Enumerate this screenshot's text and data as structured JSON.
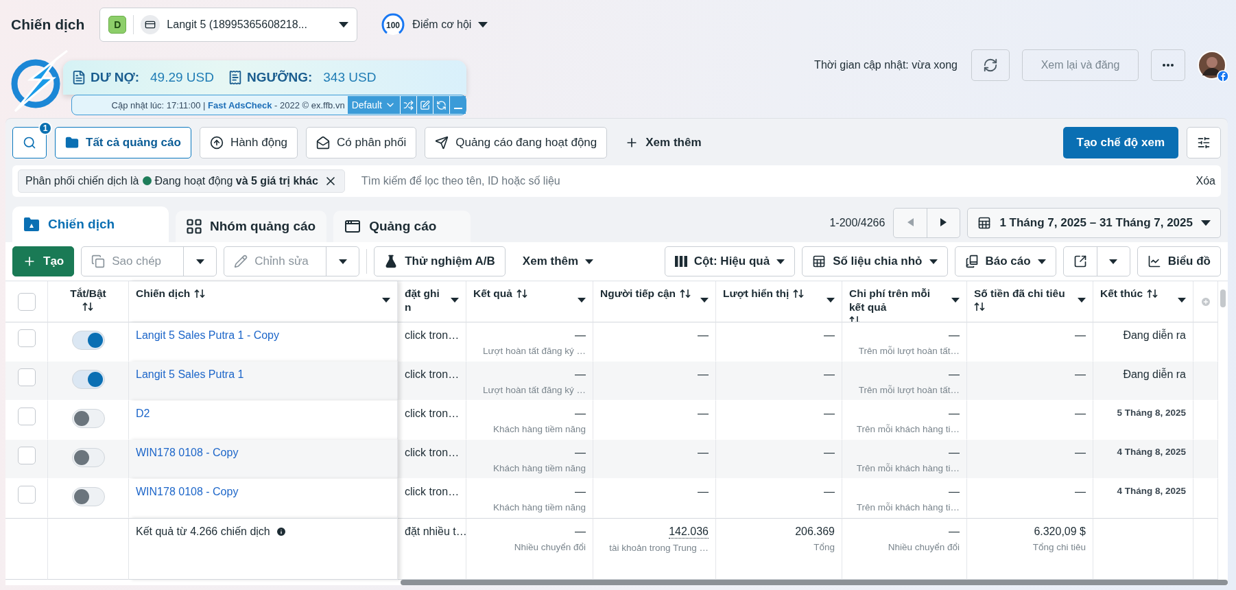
{
  "header": {
    "title": "Chiến dịch",
    "account": {
      "badge": "D",
      "name": "Langit 5 (18995365608218..."
    },
    "score": {
      "value": "100",
      "label": "Điểm cơ hội"
    },
    "update_time": "Thời gian cập nhật: vừa xong",
    "review_button": {
      "label": "Xem lại và đăng",
      "disabled": true
    }
  },
  "extension": {
    "debt_label": "DƯ NỢ:",
    "debt_value": "49.29 USD",
    "threshold_label": "NGƯỠNG:",
    "threshold_value": "343 USD",
    "status": "Cập nhật lúc: 17:11:00 | **Fast AdsCheck** - 2022 © ex.ffb.vn",
    "profile": "Default"
  },
  "filters": {
    "search_count": "1",
    "views": [
      {
        "label": "Tất cả quảng cáo",
        "selected": true,
        "kind": "folder"
      },
      {
        "label": "Hành động",
        "selected": false,
        "kind": "action"
      },
      {
        "label": "Có phân phối",
        "selected": false,
        "kind": "mail"
      },
      {
        "label": "Quảng cáo đang hoạt động",
        "selected": false,
        "kind": "send"
      }
    ],
    "more": "Xem thêm",
    "create_view": "Tạo chế độ xem",
    "chip": {
      "prefix": "Phân phối chiến dịch là",
      "status": {
        "text": "Đang hoạt động",
        "color": "#1e7d5a"
      },
      "suffix": "và 5 giá trị khác"
    },
    "search_placeholder": "Tìm kiếm để lọc theo tên, ID hoặc số liệu",
    "clear": "Xóa"
  },
  "tabs": [
    {
      "label": "Chiến dịch",
      "selected": true,
      "kind": "campaign"
    },
    {
      "label": "Nhóm quảng cáo",
      "selected": false,
      "kind": "adset"
    },
    {
      "label": "Quảng cáo",
      "selected": false,
      "kind": "ad"
    }
  ],
  "pagination": {
    "range": "1-200/4266",
    "prev_disabled": true,
    "next_disabled": false
  },
  "date_range": "1 Tháng 7, 2025 – 31 Tháng 7, 2025",
  "actions": [
    {
      "label": "Tạo",
      "kind": "primary",
      "disabled": false
    },
    {
      "label": "Sao chép",
      "kind": "copy",
      "disabled": true
    },
    {
      "label": "Chỉnh sửa",
      "kind": "edit",
      "disabled": true
    },
    {
      "label": "Thử nghiệm A/B",
      "kind": "test",
      "disabled": false
    },
    {
      "label": "Xem thêm",
      "kind": "more",
      "disabled": false
    },
    {
      "label": "Cột: Hiệu quả",
      "kind": "columns",
      "disabled": false
    },
    {
      "label": "Số liệu chia nhỏ",
      "kind": "breakdown",
      "disabled": false
    },
    {
      "label": "Báo cáo",
      "kind": "report",
      "disabled": false
    },
    {
      "kind": "export",
      "disabled": false
    },
    {
      "label": "Biểu đồ",
      "kind": "chart",
      "disabled": false
    }
  ],
  "table": {
    "all_selected": false,
    "columns": [
      {
        "label": "Tắt/Bật",
        "sortable": true
      },
      {
        "label": "Chiến dịch",
        "sortable": true
      },
      {
        "label": "đặt ghi\nn",
        "sortable": false
      },
      {
        "label": "Kết quả",
        "sortable": true
      },
      {
        "label": "Người tiếp cận",
        "sortable": true
      },
      {
        "label": "Lượt hiển thị",
        "sortable": true
      },
      {
        "label": "Chi phí trên mỗi kết quả",
        "sortable": true
      },
      {
        "label": "Số tiền đã chi tiêu",
        "sortable": true
      },
      {
        "label": "Kết thúc",
        "sortable": true
      }
    ],
    "rows": [
      {
        "selected": false,
        "cells": [
          {
            "kind": "toggle",
            "on": true
          },
          {
            "kind": "link",
            "text": "Langit 5 Sales Putra 1 - Copy"
          },
          {
            "text": "click tron…"
          },
          {
            "text": "—",
            "sub": "Lượt hoàn tất đăng ký …"
          },
          {
            "text": "—"
          },
          {
            "text": "—"
          },
          {
            "text": "—",
            "sub": "Trên mỗi lượt hoàn tất…"
          },
          {
            "text": "—"
          },
          {
            "text": "Đang diễn ra",
            "kind": "status"
          }
        ]
      },
      {
        "selected": false,
        "cells": [
          {
            "kind": "toggle",
            "on": true
          },
          {
            "kind": "link",
            "text": "Langit 5 Sales Putra 1"
          },
          {
            "text": "click tron…"
          },
          {
            "text": "—",
            "sub": "Lượt hoàn tất đăng ký …"
          },
          {
            "text": "—"
          },
          {
            "text": "—"
          },
          {
            "text": "—",
            "sub": "Trên mỗi lượt hoàn tất…"
          },
          {
            "text": "—"
          },
          {
            "text": "Đang diễn ra",
            "kind": "status"
          }
        ]
      },
      {
        "selected": false,
        "cells": [
          {
            "kind": "toggle",
            "on": false
          },
          {
            "kind": "link",
            "text": "D2"
          },
          {
            "text": "click tron…"
          },
          {
            "text": "—",
            "sub": "Khách hàng tiềm năng"
          },
          {
            "text": "—"
          },
          {
            "text": "—"
          },
          {
            "text": "—",
            "sub": "Trên mỗi khách hàng ti…"
          },
          {
            "text": "—"
          },
          {
            "text": "5 Tháng 8, 2025",
            "kind": "date"
          }
        ]
      },
      {
        "selected": false,
        "cells": [
          {
            "kind": "toggle",
            "on": false
          },
          {
            "kind": "link",
            "text": "WIN178 0108 - Copy"
          },
          {
            "text": "click tron…"
          },
          {
            "text": "—",
            "sub": "Khách hàng tiềm năng"
          },
          {
            "text": "—"
          },
          {
            "text": "—"
          },
          {
            "text": "—",
            "sub": "Trên mỗi khách hàng ti…"
          },
          {
            "text": "—"
          },
          {
            "text": "4 Tháng 8, 2025",
            "kind": "date"
          }
        ]
      },
      {
        "selected": false,
        "cells": [
          {
            "kind": "toggle",
            "on": false
          },
          {
            "kind": "link",
            "text": "WIN178 0108 - Copy"
          },
          {
            "text": "click tron…"
          },
          {
            "text": "—",
            "sub": "Khách hàng tiềm năng"
          },
          {
            "text": "—"
          },
          {
            "text": "—"
          },
          {
            "text": "—",
            "sub": "Trên mỗi khách hàng ti…"
          },
          {
            "text": "—"
          },
          {
            "text": "4 Tháng 8, 2025",
            "kind": "date"
          }
        ]
      }
    ],
    "footer": {
      "cells": [
        {
          "text": ""
        },
        {
          "text": "Kết quả từ 4.266 chiến dịch",
          "kind": "summary"
        },
        {
          "text": "đặt nhiều t…"
        },
        {
          "text": "—",
          "sub": "Nhiều chuyển đổi"
        },
        {
          "text": "142.036",
          "sub": "tài khoản trong Trung …",
          "kind": "dotted"
        },
        {
          "text": "206.369",
          "sub": "Tổng"
        },
        {
          "text": "—",
          "sub": "Nhiều chuyển đổi"
        },
        {
          "text": "6.320,09 $",
          "sub": "Tổng chi tiêu"
        },
        {
          "text": ""
        }
      ]
    }
  }
}
